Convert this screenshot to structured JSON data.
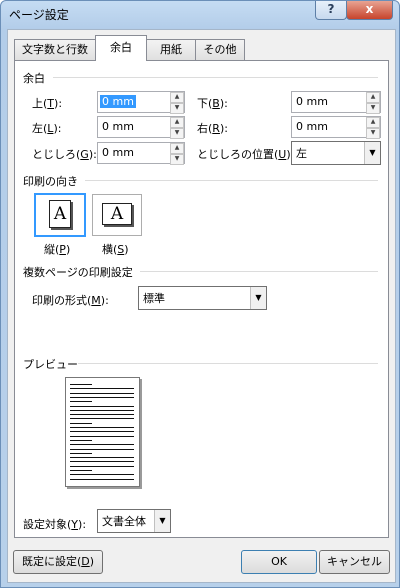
{
  "window": {
    "title": "ページ設定",
    "help_label": "?",
    "close_label": "x"
  },
  "tabs": [
    {
      "label": "文字数と行数"
    },
    {
      "label": "余白"
    },
    {
      "label": "用紙"
    },
    {
      "label": "その他"
    }
  ],
  "margins": {
    "heading": "余白",
    "top": {
      "label": "上(",
      "key": "T",
      "suffix": "):",
      "value": "0 mm"
    },
    "bottom": {
      "label": "下(",
      "key": "B",
      "suffix": "):",
      "value": "0 mm"
    },
    "left": {
      "label": "左(",
      "key": "L",
      "suffix": "):",
      "value": "0 mm"
    },
    "right": {
      "label": "右(",
      "key": "R",
      "suffix": "):",
      "value": "0 mm"
    },
    "gutter": {
      "label": "とじしろ(",
      "key": "G",
      "suffix": "):",
      "value": "0 mm"
    },
    "gutter_position": {
      "label": "とじしろの位置(",
      "key": "U",
      "suffix": "):",
      "value": "左"
    }
  },
  "orientation": {
    "heading": "印刷の向き",
    "icon_letter": "A",
    "portrait": {
      "label": "縦(",
      "key": "P",
      "suffix": ")",
      "selected": true
    },
    "landscape": {
      "label": "横(",
      "key": "S",
      "suffix": ")",
      "selected": false
    }
  },
  "multiple_pages": {
    "heading": "複数ページの印刷設定",
    "label": "印刷の形式(",
    "key": "M",
    "suffix": "):",
    "value": "標準"
  },
  "preview": {
    "heading": "プレビュー"
  },
  "apply_to": {
    "label": "設定対象(",
    "key": "Y",
    "suffix": "):",
    "value": "文書全体"
  },
  "buttons": {
    "default": {
      "label": "既定に設定(",
      "key": "D",
      "suffix": ")"
    },
    "ok": "OK",
    "cancel": "キャンセル"
  },
  "colors": {
    "selection": "#3399ff",
    "title_bar": "#b9d1ea",
    "close": "#c7442c"
  }
}
